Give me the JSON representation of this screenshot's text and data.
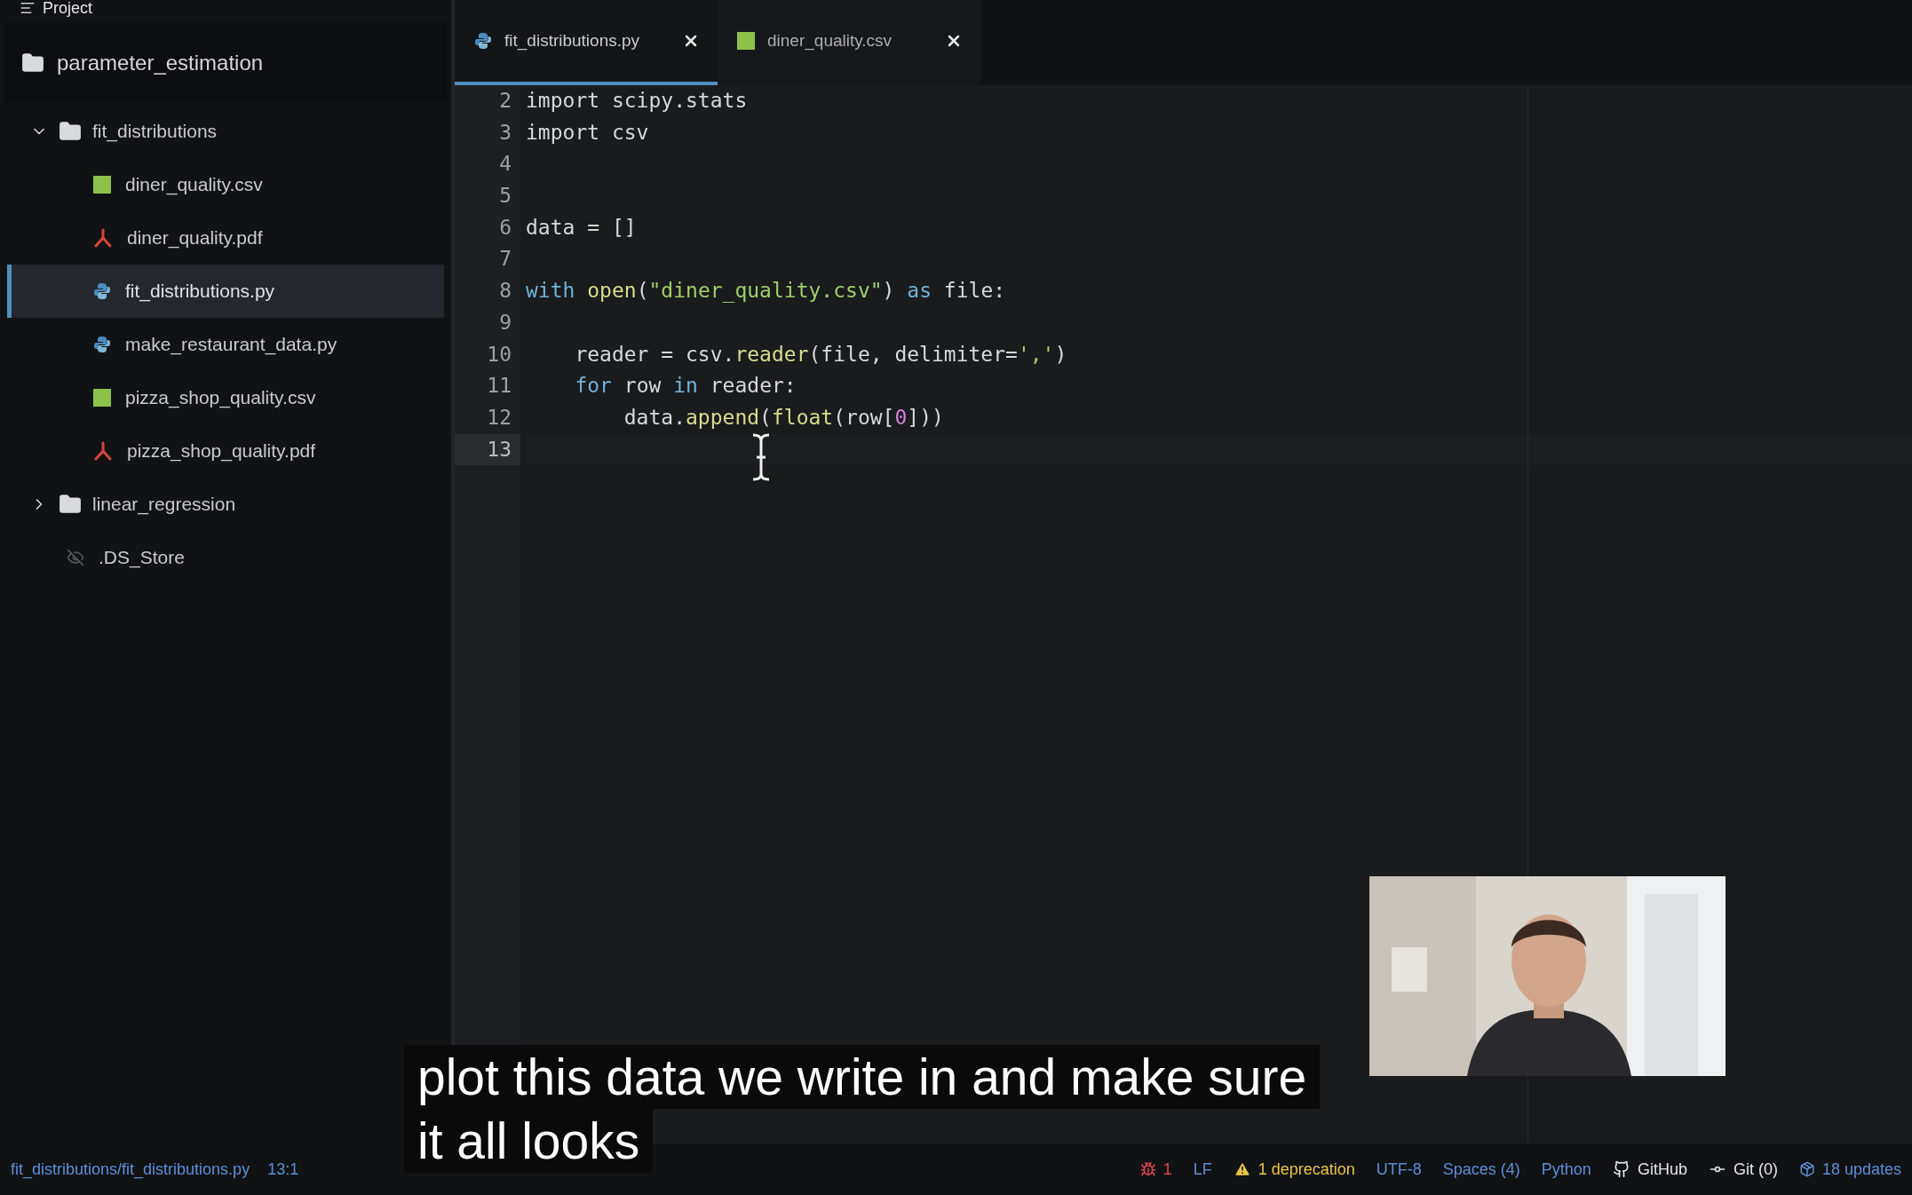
{
  "sidebar": {
    "title": "Project",
    "root": "parameter_estimation",
    "tree": [
      {
        "kind": "folder",
        "label": "fit_distributions",
        "expanded": true,
        "selected": false,
        "children": [
          {
            "kind": "csv",
            "label": "diner_quality.csv",
            "selected": false
          },
          {
            "kind": "pdf",
            "label": "diner_quality.pdf",
            "selected": false
          },
          {
            "kind": "py",
            "label": "fit_distributions.py",
            "selected": true
          },
          {
            "kind": "py",
            "label": "make_restaurant_data.py",
            "selected": false
          },
          {
            "kind": "csv",
            "label": "pizza_shop_quality.csv",
            "selected": false
          },
          {
            "kind": "pdf",
            "label": "pizza_shop_quality.pdf",
            "selected": false
          }
        ]
      },
      {
        "kind": "folder",
        "label": "linear_regression",
        "expanded": false,
        "selected": false
      },
      {
        "kind": "ignored",
        "label": ".DS_Store",
        "selected": false
      }
    ]
  },
  "tabs": [
    {
      "kind": "py",
      "label": "fit_distributions.py",
      "selected": true
    },
    {
      "kind": "csv",
      "label": "diner_quality.csv",
      "selected": false
    }
  ],
  "editor": {
    "lines": [
      {
        "number": "2",
        "current": false,
        "tokens": [
          {
            "kind": "plain",
            "text": "import scipy.stats"
          }
        ]
      },
      {
        "number": "3",
        "current": false,
        "tokens": [
          {
            "kind": "plain",
            "text": "import csv"
          }
        ]
      },
      {
        "number": "4",
        "current": false
      },
      {
        "number": "5",
        "current": false
      },
      {
        "number": "6",
        "current": false,
        "tokens": [
          {
            "kind": "plain",
            "text": "data = []"
          }
        ]
      },
      {
        "number": "7",
        "current": false
      },
      {
        "number": "8",
        "current": false,
        "tokens": [
          {
            "kind": "keyword",
            "text": "with"
          },
          {
            "kind": "function",
            "text": " open"
          },
          {
            "kind": "plain",
            "text": "("
          },
          {
            "kind": "string",
            "text": "\"diner_quality.csv\""
          },
          {
            "kind": "plain",
            "text": ") "
          },
          {
            "kind": "keyword",
            "text": "as"
          },
          {
            "kind": "plain",
            "text": " file:"
          }
        ]
      },
      {
        "number": "9",
        "current": false
      },
      {
        "number": "10",
        "current": false,
        "tokens": [
          {
            "kind": "plain",
            "text": "    reader = csv."
          },
          {
            "kind": "function",
            "text": "reader"
          },
          {
            "kind": "plain",
            "text": "(file, delimiter="
          },
          {
            "kind": "string",
            "text": "','"
          },
          {
            "kind": "plain",
            "text": ")"
          }
        ]
      },
      {
        "number": "11",
        "current": false,
        "tokens": [
          {
            "kind": "keyword",
            "text": "    for"
          },
          {
            "kind": "plain",
            "text": " row "
          },
          {
            "kind": "keyword",
            "text": "in"
          },
          {
            "kind": "plain",
            "text": " reader:"
          }
        ]
      },
      {
        "number": "12",
        "current": false,
        "tokens": [
          {
            "kind": "plain",
            "text": "        data."
          },
          {
            "kind": "function",
            "text": "append"
          },
          {
            "kind": "plain",
            "text": "("
          },
          {
            "kind": "function",
            "text": "float"
          },
          {
            "kind": "plain",
            "text": "(row["
          },
          {
            "kind": "number",
            "text": "0"
          },
          {
            "kind": "plain",
            "text": "]))"
          }
        ]
      },
      {
        "number": "13",
        "current": true
      }
    ]
  },
  "webcam": {
    "kind": "picture"
  },
  "subtitles": [
    "plot this data we write in and make sure",
    "it all looks"
  ],
  "status_bar": {
    "path": "fit_distributions/fit_distributions.py",
    "position": "13:1",
    "items": [
      {
        "kind": "errors",
        "text": "1"
      },
      {
        "kind": "plain",
        "text": "LF"
      },
      {
        "kind": "warnings",
        "text": "1 deprecation"
      },
      {
        "kind": "plain",
        "text": "UTF-8"
      },
      {
        "kind": "plain",
        "text": "Spaces (4)"
      },
      {
        "kind": "plain",
        "text": "Python"
      },
      {
        "kind": "github",
        "text": "GitHub"
      },
      {
        "kind": "git",
        "text": "Git (0)"
      },
      {
        "kind": "updates",
        "text": "18 updates"
      }
    ]
  }
}
